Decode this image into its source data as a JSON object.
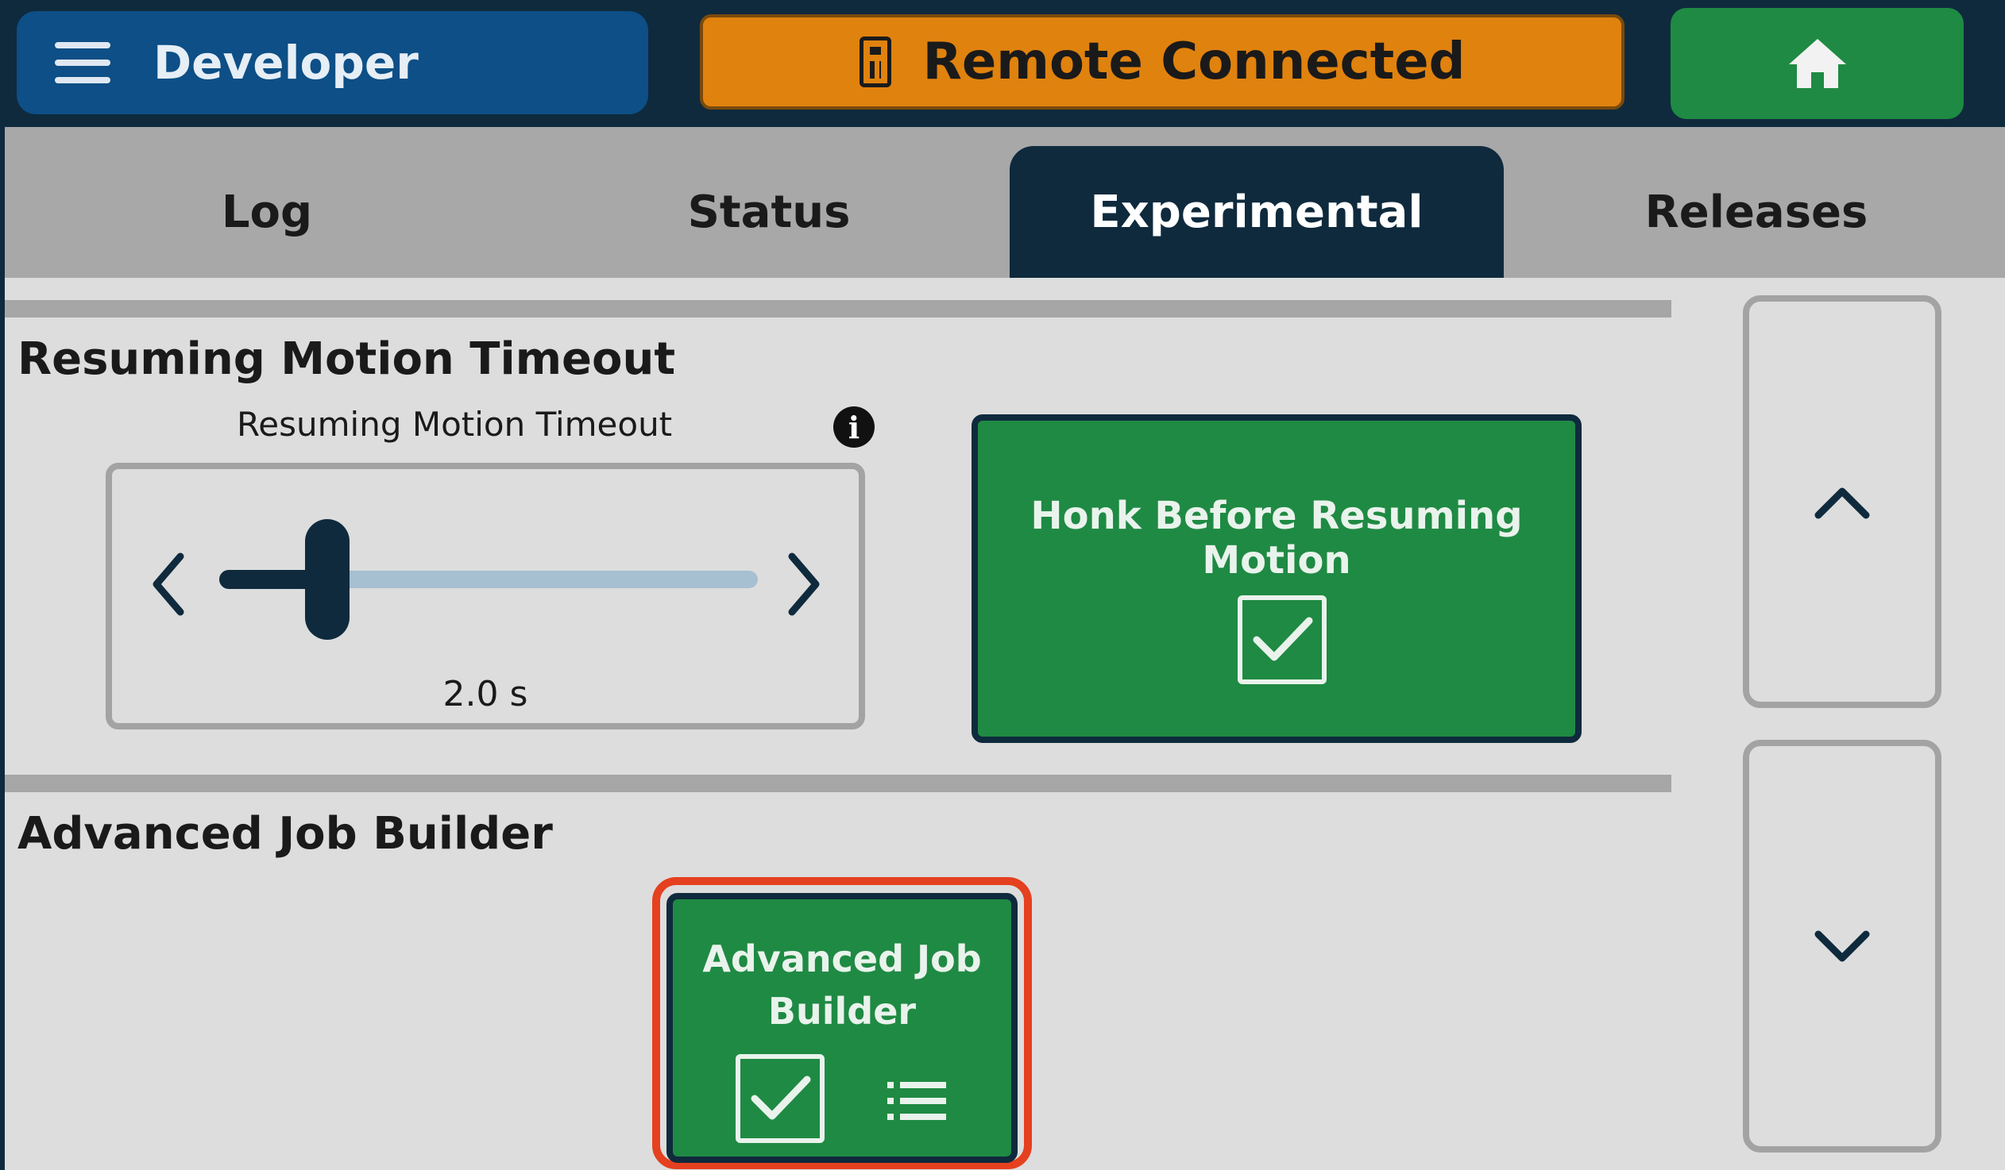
{
  "header": {
    "menu_title": "Developer",
    "remote_status": "Remote Connected",
    "home_label": "home"
  },
  "tabs": [
    {
      "label": "Log",
      "active": false
    },
    {
      "label": "Status",
      "active": false
    },
    {
      "label": "Experimental",
      "active": true
    },
    {
      "label": "Releases",
      "active": false
    }
  ],
  "sections": {
    "resuming": {
      "title": "Resuming Motion Timeout",
      "slider_label": "Resuming Motion Timeout",
      "slider_value_text": "2.0 s",
      "slider_fraction": 0.2,
      "honk_label": "Honk Before Resuming Motion",
      "honk_checked": true
    },
    "advanced": {
      "title": "Advanced Job Builder",
      "card_label_line1": "Advanced Job",
      "card_label_line2": "Builder",
      "checked": true
    }
  },
  "colors": {
    "navy": "#0f2a3d",
    "blue": "#0d4f86",
    "orange": "#e0820e",
    "green": "#1f8a43",
    "highlight": "#e5401f"
  },
  "icons": {
    "menu": "hamburger-icon",
    "remote": "remote-control-icon",
    "home": "home-icon",
    "info": "info-icon",
    "left": "chevron-left-icon",
    "right": "chevron-right-icon",
    "up": "chevron-up-icon",
    "down": "chevron-down-icon",
    "check": "checkmark-icon",
    "list": "list-icon"
  }
}
